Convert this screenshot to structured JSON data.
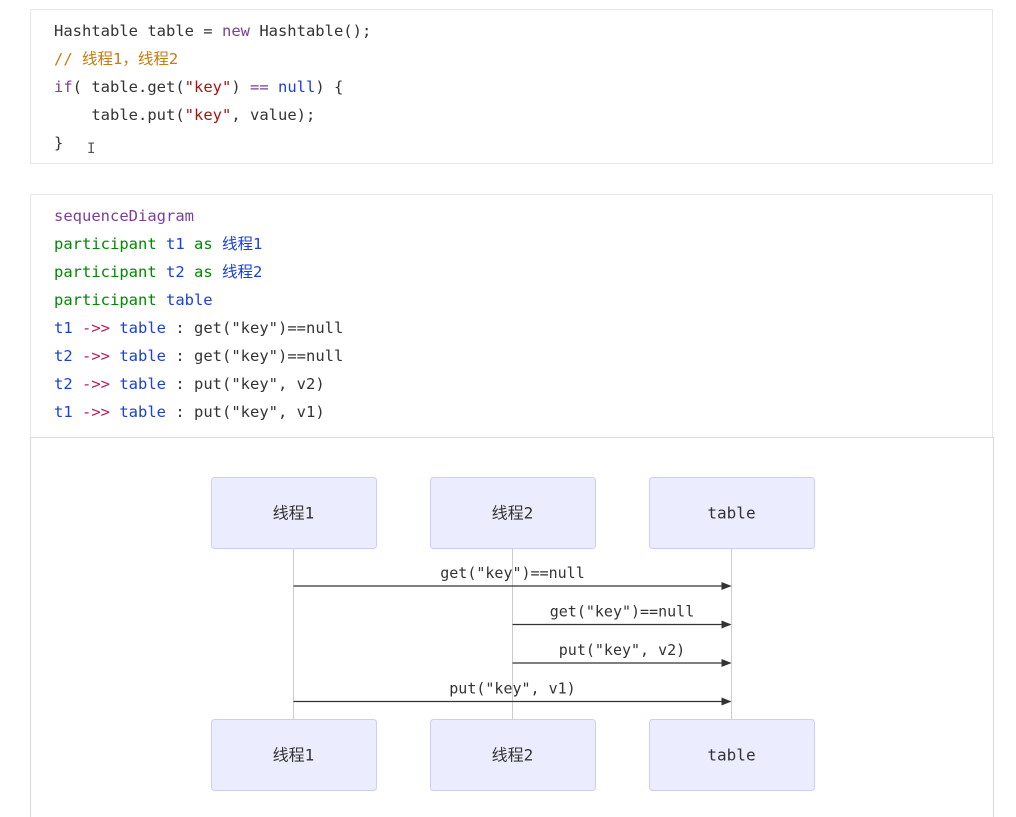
{
  "colors": {
    "plain": "#333333",
    "keyword_purple": "#7a3e9d",
    "keyword_green": "#008800",
    "identifier_blue": "#1a3fd6",
    "string_red": "#a31515",
    "comment_orange": "#c97a10",
    "arrow_red": "#c2185b",
    "actor_fill": "#ececff",
    "actor_border": "#ccccff",
    "lifeline": "#cccccc",
    "message_line": "#333333"
  },
  "code_block_1": {
    "lines": [
      [
        {
          "t": "Hashtable table = ",
          "c": "plain"
        },
        {
          "t": "new",
          "c": "keyword_purple"
        },
        {
          "t": " Hashtable();",
          "c": "plain"
        }
      ],
      [
        {
          "t": "// 线程1，线程2",
          "c": "comment_orange"
        }
      ],
      [
        {
          "t": "if",
          "c": "keyword_purple"
        },
        {
          "t": "( table.get(",
          "c": "plain"
        },
        {
          "t": "\"key\"",
          "c": "string_red"
        },
        {
          "t": ") ",
          "c": "plain"
        },
        {
          "t": "==",
          "c": "keyword_purple"
        },
        {
          "t": " ",
          "c": "plain"
        },
        {
          "t": "null",
          "c": "identifier_blue"
        },
        {
          "t": ") {",
          "c": "plain"
        }
      ],
      [
        {
          "t": "    table.put(",
          "c": "plain"
        },
        {
          "t": "\"key\"",
          "c": "string_red"
        },
        {
          "t": ", value);",
          "c": "plain"
        }
      ],
      [
        {
          "t": "}",
          "c": "plain"
        }
      ]
    ]
  },
  "code_block_2": {
    "lines": [
      [
        {
          "t": "sequenceDiagram",
          "c": "keyword_purple"
        }
      ],
      [
        {
          "t": "participant ",
          "c": "keyword_green"
        },
        {
          "t": "t1",
          "c": "identifier_blue"
        },
        {
          "t": " as ",
          "c": "keyword_green"
        },
        {
          "t": "线程1",
          "c": "identifier_blue"
        }
      ],
      [
        {
          "t": "participant ",
          "c": "keyword_green"
        },
        {
          "t": "t2",
          "c": "identifier_blue"
        },
        {
          "t": " as ",
          "c": "keyword_green"
        },
        {
          "t": "线程2",
          "c": "identifier_blue"
        }
      ],
      [
        {
          "t": "participant ",
          "c": "keyword_green"
        },
        {
          "t": "table",
          "c": "identifier_blue"
        }
      ],
      [
        {
          "t": "t1",
          "c": "identifier_blue"
        },
        {
          "t": " ->> ",
          "c": "arrow_red"
        },
        {
          "t": "table",
          "c": "identifier_blue"
        },
        {
          "t": " : get(\"key\")==null",
          "c": "plain"
        }
      ],
      [
        {
          "t": "t2",
          "c": "identifier_blue"
        },
        {
          "t": " ->> ",
          "c": "arrow_red"
        },
        {
          "t": "table",
          "c": "identifier_blue"
        },
        {
          "t": " : get(\"key\")==null",
          "c": "plain"
        }
      ],
      [
        {
          "t": "t2",
          "c": "identifier_blue"
        },
        {
          "t": " ->> ",
          "c": "arrow_red"
        },
        {
          "t": "table",
          "c": "identifier_blue"
        },
        {
          "t": " : put(\"key\", v2)",
          "c": "plain"
        }
      ],
      [
        {
          "t": "t1",
          "c": "identifier_blue"
        },
        {
          "t": " ->> ",
          "c": "arrow_red"
        },
        {
          "t": "table",
          "c": "identifier_blue"
        },
        {
          "t": " : put(\"key\", v1)",
          "c": "plain"
        }
      ]
    ]
  },
  "diagram": {
    "participants": [
      {
        "id": "t1",
        "label": "线程1"
      },
      {
        "id": "t2",
        "label": "线程2"
      },
      {
        "id": "table",
        "label": "table"
      }
    ],
    "messages": [
      {
        "from": "t1",
        "to": "table",
        "label": "get(\"key\")==null"
      },
      {
        "from": "t2",
        "to": "table",
        "label": "get(\"key\")==null"
      },
      {
        "from": "t2",
        "to": "table",
        "label": "put(\"key\", v2)"
      },
      {
        "from": "t1",
        "to": "table",
        "label": "put(\"key\", v1)"
      }
    ]
  }
}
